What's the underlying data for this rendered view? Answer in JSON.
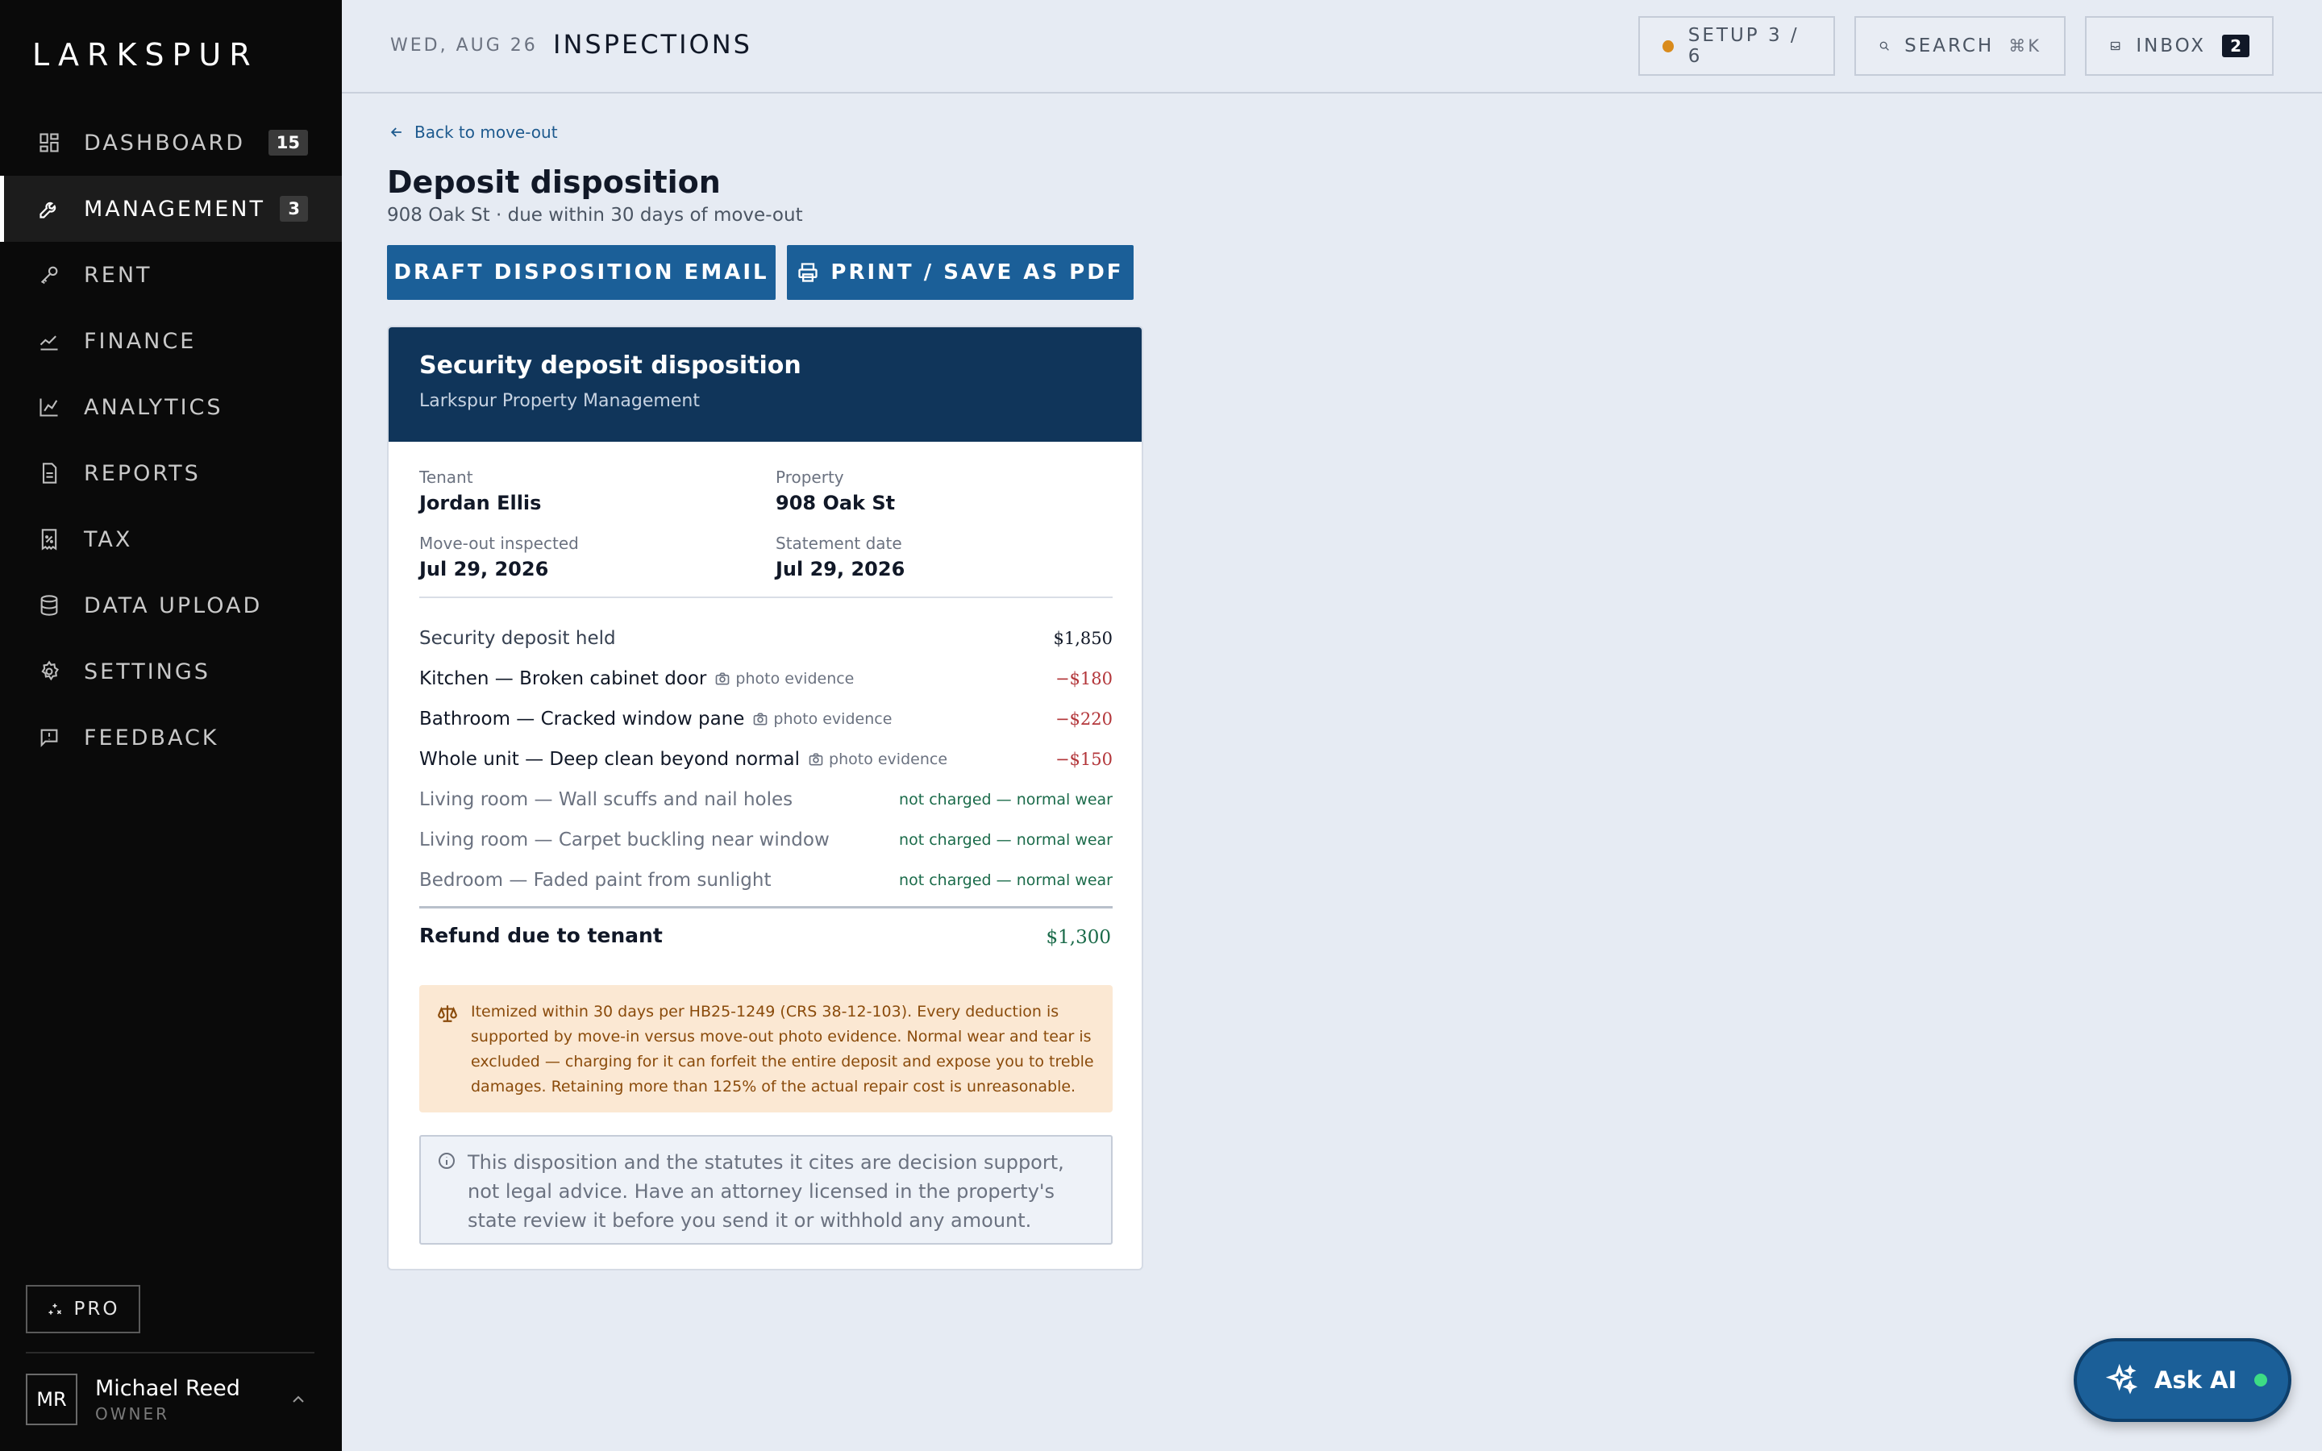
{
  "brand": "LARKSPUR",
  "sidebar": {
    "items": [
      {
        "label": "DASHBOARD",
        "badge": "15",
        "icon": "grid-icon"
      },
      {
        "label": "MANAGEMENT",
        "badge": "3",
        "icon": "wrench-icon",
        "active": true
      },
      {
        "label": "RENT",
        "badge": "",
        "icon": "key-icon"
      },
      {
        "label": "FINANCE",
        "badge": "",
        "icon": "trend-icon"
      },
      {
        "label": "ANALYTICS",
        "badge": "",
        "icon": "bar-chart-icon"
      },
      {
        "label": "REPORTS",
        "badge": "",
        "icon": "document-icon"
      },
      {
        "label": "TAX",
        "badge": "",
        "icon": "receipt-icon"
      },
      {
        "label": "DATA UPLOAD",
        "badge": "",
        "icon": "database-icon"
      },
      {
        "label": "SETTINGS",
        "badge": "",
        "icon": "gear-icon"
      },
      {
        "label": "FEEDBACK",
        "badge": "",
        "icon": "feedback-icon"
      }
    ],
    "pro_label": "PRO",
    "user": {
      "initials": "MR",
      "name": "Michael Reed",
      "role": "OWNER"
    }
  },
  "header": {
    "date": "WED, AUG 26",
    "title": "INSPECTIONS",
    "setup_label": "SETUP 3 / 6",
    "search_label": "SEARCH",
    "search_shortcut": "⌘K",
    "inbox_label": "INBOX",
    "inbox_count": "2"
  },
  "page": {
    "back_label": "Back to move-out",
    "title": "Deposit disposition",
    "subtitle": "908 Oak St · due within 30 days of move-out",
    "draft_button": "DRAFT DISPOSITION EMAIL",
    "print_button": "PRINT / SAVE AS PDF"
  },
  "card": {
    "title": "Security deposit disposition",
    "subtitle": "Larkspur Property Management",
    "tenant_label": "Tenant",
    "tenant": "Jordan Ellis",
    "property_label": "Property",
    "property": "908 Oak St",
    "inspected_label": "Move-out inspected",
    "inspected": "Jul 29, 2026",
    "statement_label": "Statement date",
    "statement": "Jul 29, 2026",
    "lines": [
      {
        "label": "Security deposit held",
        "amount": "$1,850",
        "kind": "held"
      },
      {
        "label": "Kitchen — Broken cabinet door",
        "evidence": "photo evidence",
        "amount": "−$180",
        "kind": "deduction"
      },
      {
        "label": "Bathroom — Cracked window pane",
        "evidence": "photo evidence",
        "amount": "−$220",
        "kind": "deduction"
      },
      {
        "label": "Whole unit — Deep clean beyond normal",
        "evidence": "photo evidence",
        "amount": "−$150",
        "kind": "deduction"
      },
      {
        "label": "Living room — Wall scuffs and nail holes",
        "amount": "not charged — normal wear",
        "kind": "wear"
      },
      {
        "label": "Living room — Carpet buckling near window",
        "amount": "not charged — normal wear",
        "kind": "wear"
      },
      {
        "label": "Bedroom — Faded paint from sunlight",
        "amount": "not charged — normal wear",
        "kind": "wear"
      }
    ],
    "refund_label": "Refund due to tenant",
    "refund_amount": "$1,300",
    "legal_note": "Itemized within 30 days per HB25-1249 (CRS 38-12-103). Every deduction is supported by move-in versus move-out photo evidence. Normal wear and tear is excluded — charging for it can forfeit the entire deposit and expose you to treble damages. Retaining more than 125% of the actual repair cost is unreasonable.",
    "disclaimer": "This disposition and the statutes it cites are decision support, not legal advice. Have an attorney licensed in the property's state review it before you send it or withhold any amount."
  },
  "ask_ai": "Ask AI",
  "colors": {
    "sidebar_bg": "#0a0a0a",
    "primary": "#1b5f98",
    "card_header": "#10355a",
    "deduction": "#b3363a",
    "positive": "#1b6b4a",
    "warning_bg": "#fbe8d3",
    "setup_dot": "#d98b1c"
  }
}
